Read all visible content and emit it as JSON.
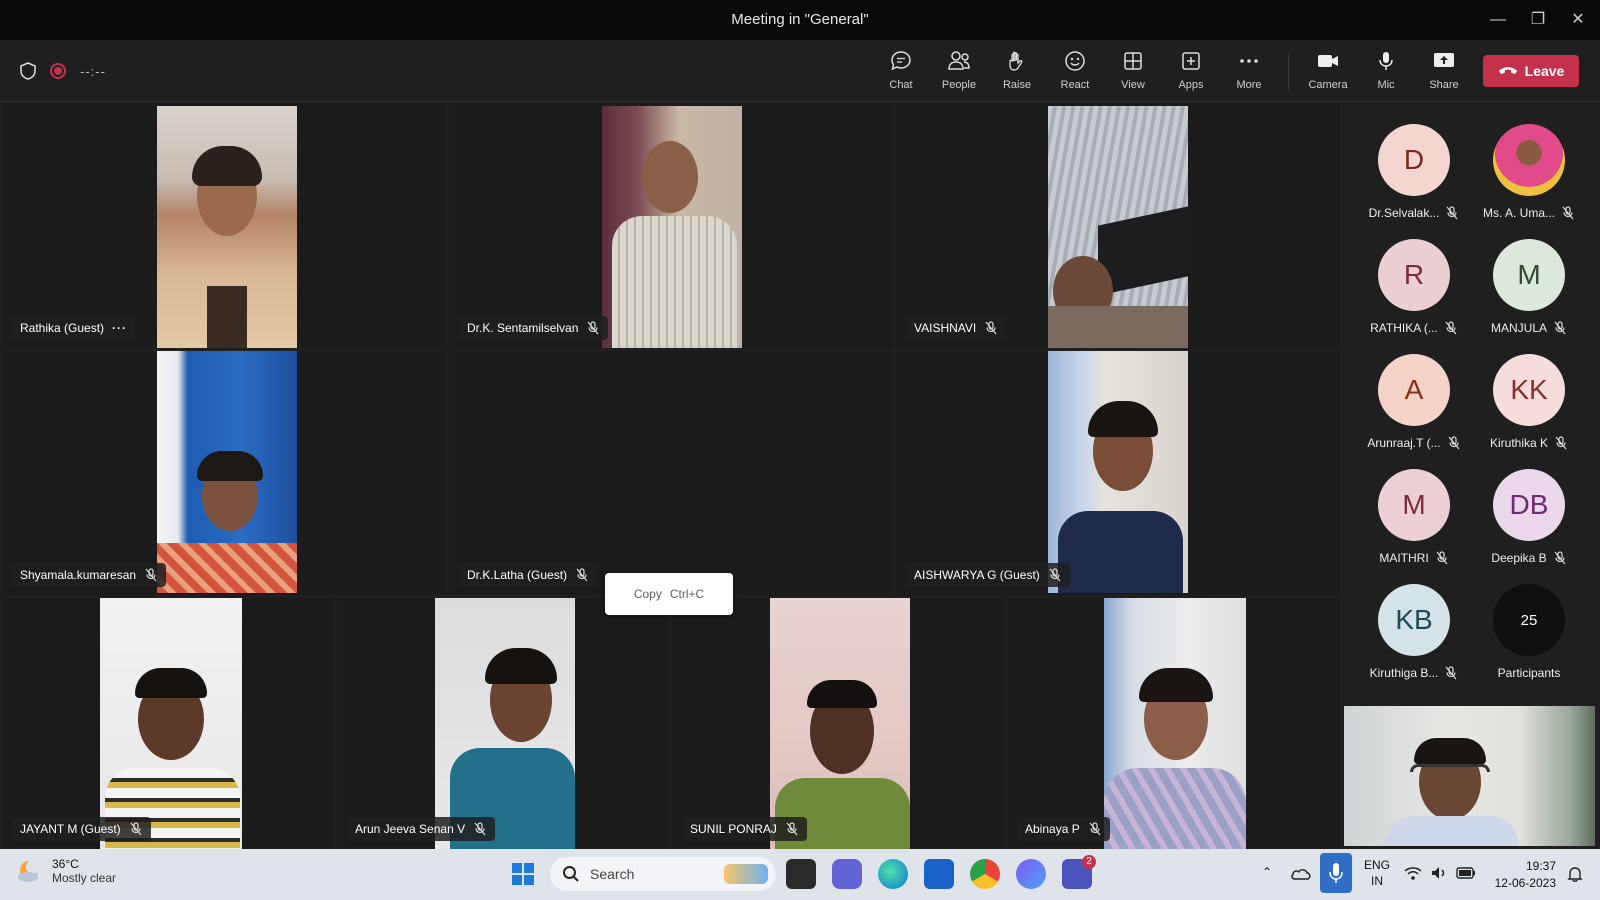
{
  "window": {
    "title": "Meeting in \"General\""
  },
  "toolbar": {
    "timer": "--:--",
    "chat": "Chat",
    "people": "People",
    "raise": "Raise",
    "react": "React",
    "view": "View",
    "apps": "Apps",
    "more": "More",
    "camera": "Camera",
    "mic": "Mic",
    "share": "Share",
    "leave": "Leave"
  },
  "tiles": [
    {
      "name": "Rathika (Guest)",
      "more": "···"
    },
    {
      "name": "Dr.K. Sentamilselvan"
    },
    {
      "name": "VAISHNAVI"
    },
    {
      "name": "Shyamala.kumaresan"
    },
    {
      "name": "Dr.K.Latha (Guest)"
    },
    {
      "name": "AISHWARYA G (Guest)"
    },
    {
      "name": "JAYANT M (Guest)"
    },
    {
      "name": "Arun Jeeva Senan V"
    },
    {
      "name": "SUNIL PONRAJ"
    },
    {
      "name": "Abinaya P"
    }
  ],
  "context_menu": {
    "label": "Copy",
    "shortcut": "Ctrl+C"
  },
  "roster": [
    {
      "initials": "D",
      "name": "Dr.Selvalak...",
      "color": "#f3d6cf",
      "text": "#7a2c1c"
    },
    {
      "initials": "",
      "name": "Ms. A. Uma...",
      "color": "#d99d6b",
      "text": "#fff"
    },
    {
      "initials": "R",
      "name": "RATHIKA (...",
      "color": "#eccfd3",
      "text": "#7d2d3a"
    },
    {
      "initials": "M",
      "name": "MANJULA",
      "color": "#dde8dc",
      "text": "#2f4a2e"
    },
    {
      "initials": "A",
      "name": "Arunraaj.T (...",
      "color": "#f6d3c8",
      "text": "#8a2e16"
    },
    {
      "initials": "KK",
      "name": "Kiruthika K",
      "color": "#f7dcdc",
      "text": "#8a2f2f"
    },
    {
      "initials": "M",
      "name": "MAITHRI",
      "color": "#ecd0d5",
      "text": "#7d2d3a"
    },
    {
      "initials": "DB",
      "name": "Deepika B",
      "color": "#ead8ea",
      "text": "#6a2f6a"
    },
    {
      "initials": "KB",
      "name": "Kiruthiga B...",
      "color": "#d3e3e8",
      "text": "#1e4a58"
    },
    {
      "initials": "25",
      "name": "Participants",
      "color": "#0f0f0f",
      "text": "#fff"
    }
  ],
  "taskbar": {
    "temp": "36°C",
    "condition": "Mostly clear",
    "search": "Search",
    "lang1": "ENG",
    "lang2": "IN",
    "time": "19:37",
    "date": "12-06-2023",
    "teams_badge": "2"
  },
  "colors": {
    "leave": "#c4314b",
    "toolbar": "#1f1f1f",
    "taskbar": "#dfe3ea"
  }
}
